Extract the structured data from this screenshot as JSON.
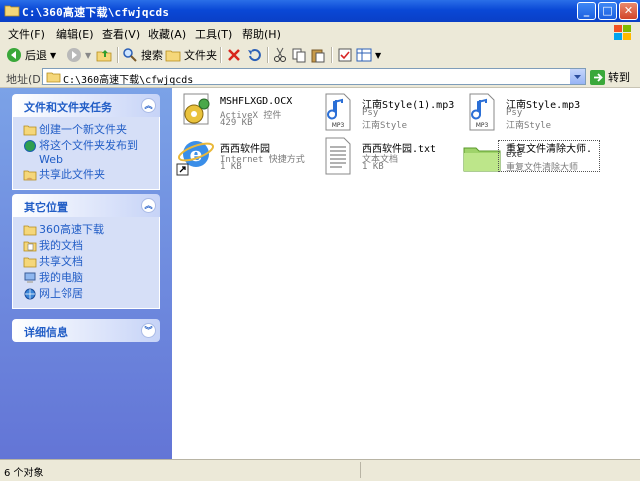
{
  "window": {
    "title": "C:\\360高速下载\\cfwjqcds"
  },
  "menu": [
    "文件(F)",
    "编辑(E)",
    "查看(V)",
    "收藏(A)",
    "工具(T)",
    "帮助(H)"
  ],
  "toolbar": {
    "back": "后退",
    "search": "搜索",
    "folders": "文件夹"
  },
  "address": {
    "label": "地址(D)",
    "value": "C:\\360高速下载\\cfwjqcds",
    "go": "转到"
  },
  "sidebar": {
    "tasks": {
      "title": "文件和文件夹任务",
      "items": [
        "创建一个新文件夹",
        "将这个文件夹发布到",
        "Web",
        "共享此文件夹"
      ]
    },
    "places": {
      "title": "其它位置",
      "items": [
        "360高速下载",
        "我的文档",
        "共享文档",
        "我的电脑",
        "网上邻居"
      ]
    },
    "details": {
      "title": "详细信息"
    }
  },
  "files": [
    {
      "name": "MSHFLXGD.OCX",
      "line2": "ActiveX 控件",
      "line3": "429 KB",
      "icon": "activex-gear-icon"
    },
    {
      "name": "江南Style(1).mp3",
      "line2": "Psy",
      "line3": "江南Style",
      "icon": "mp3-file-icon"
    },
    {
      "name": "江南Style.mp3",
      "line2": "Psy",
      "line3": "江南Style",
      "icon": "mp3-file-icon"
    },
    {
      "name": "西西软件园",
      "line2": "Internet 快捷方式",
      "line3": "1 KB",
      "icon": "internet-explorer-icon"
    },
    {
      "name": "西西软件园.txt",
      "line2": "文本文档",
      "line3": "1 KB",
      "icon": "text-document-icon"
    },
    {
      "name": "重复文件清除大师.",
      "line2": "exe",
      "line3": "重复文件清除大师",
      "icon": "cleaner-exe-icon"
    }
  ],
  "status": {
    "text": "6 个对象"
  },
  "colors": {
    "title_blue": "#0a48d6",
    "sidebar_blue": "#6375d6",
    "link_blue": "#215dc6",
    "chrome": "#ece9d8"
  }
}
